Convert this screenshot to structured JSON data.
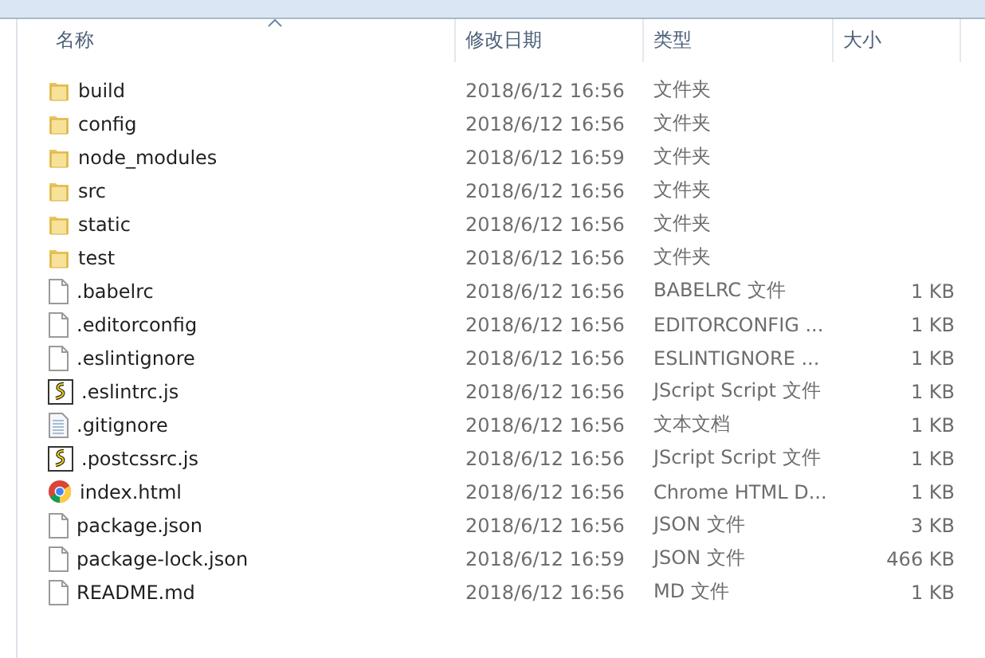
{
  "table": {
    "columns": [
      {
        "label": "名称",
        "sorted": true
      },
      {
        "label": "修改日期",
        "sorted": false
      },
      {
        "label": "类型",
        "sorted": false
      },
      {
        "label": "大小",
        "sorted": false
      }
    ],
    "rows": [
      {
        "kind": "folder",
        "name": "build",
        "modified": "2018/6/12 16:56",
        "type": "文件夹"
      },
      {
        "kind": "folder",
        "name": "config",
        "modified": "2018/6/12 16:56",
        "type": "文件夹"
      },
      {
        "kind": "folder",
        "name": "node_modules",
        "modified": "2018/6/12 16:59",
        "type": "文件夹"
      },
      {
        "kind": "folder",
        "name": "src",
        "modified": "2018/6/12 16:56",
        "type": "文件夹"
      },
      {
        "kind": "folder",
        "name": "static",
        "modified": "2018/6/12 16:56",
        "type": "文件夹"
      },
      {
        "kind": "folder",
        "name": "test",
        "modified": "2018/6/12 16:56",
        "type": "文件夹"
      },
      {
        "kind": "file",
        "name": ".babelrc",
        "modified": "2018/6/12 16:56",
        "type": "BABELRC 文件",
        "size": "1 KB"
      },
      {
        "kind": "file",
        "name": ".editorconfig",
        "modified": "2018/6/12 16:56",
        "type": "EDITORCONFIG ...",
        "size": "1 KB"
      },
      {
        "kind": "file",
        "name": ".eslintignore",
        "modified": "2018/6/12 16:56",
        "type": "ESLINTIGNORE ...",
        "size": "1 KB"
      },
      {
        "kind": "script",
        "name": ".eslintrc.js",
        "modified": "2018/6/12 16:56",
        "type": "JScript Script 文件",
        "size": "1 KB"
      },
      {
        "kind": "text",
        "name": ".gitignore",
        "modified": "2018/6/12 16:56",
        "type": "文本文档",
        "size": "1 KB"
      },
      {
        "kind": "script",
        "name": ".postcssrc.js",
        "modified": "2018/6/12 16:56",
        "type": "JScript Script 文件",
        "size": "1 KB"
      },
      {
        "kind": "browser",
        "name": "index.html",
        "modified": "2018/6/12 16:56",
        "type": "Chrome HTML D...",
        "size": "1 KB"
      },
      {
        "kind": "file",
        "name": "package.json",
        "modified": "2018/6/12 16:56",
        "type": "JSON 文件",
        "size": "3 KB"
      },
      {
        "kind": "file",
        "name": "package-lock.json",
        "modified": "2018/6/12 16:59",
        "type": "JSON 文件",
        "size": "466 KB"
      },
      {
        "kind": "file",
        "name": "README.md",
        "modified": "2018/6/12 16:56",
        "type": "MD 文件",
        "size": "1 KB"
      }
    ]
  }
}
